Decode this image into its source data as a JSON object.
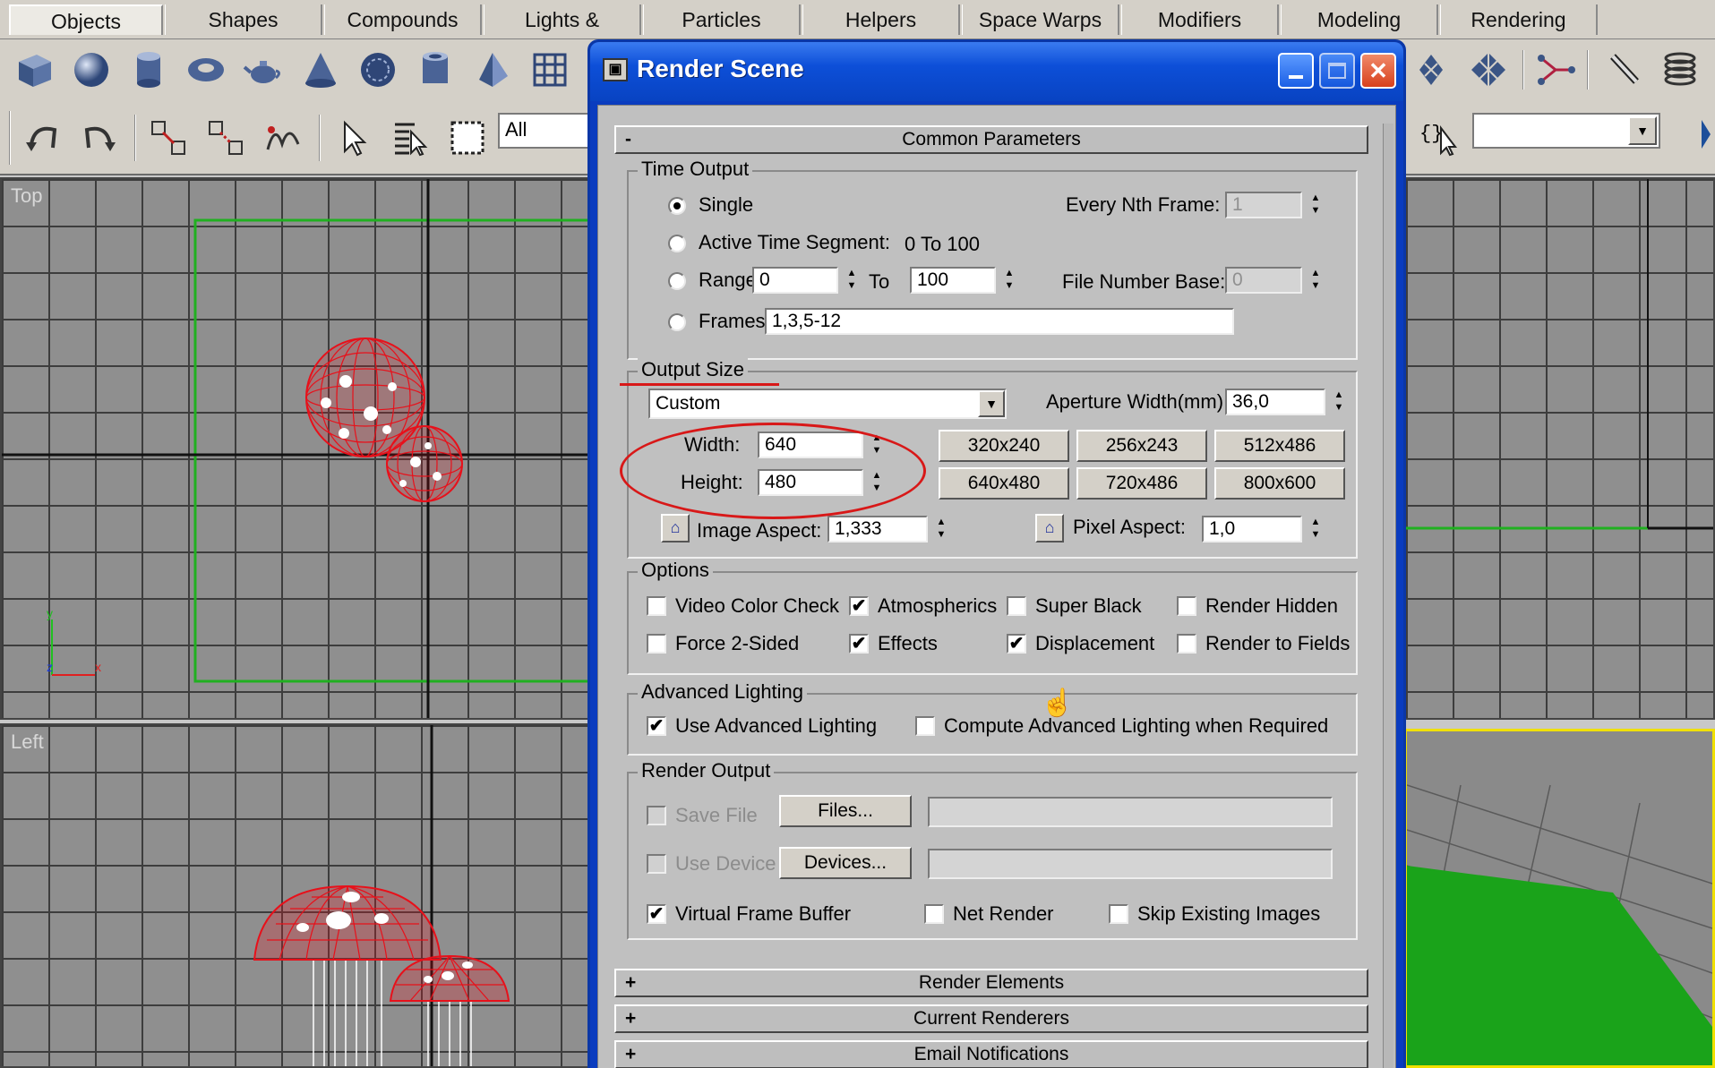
{
  "tabs": [
    "Objects",
    "Shapes",
    "Compounds",
    "Lights & Cameras",
    "Particles",
    "Helpers",
    "Space Warps",
    "Modifiers",
    "Modeling",
    "Rendering"
  ],
  "toolbar": {
    "icons1": [
      "box-icon",
      "sphere-icon",
      "cylinder-icon",
      "torus-icon",
      "teapot-icon",
      "cone-icon",
      "geosphere-icon",
      "tube-icon",
      "pyramid-icon",
      "plane-icon"
    ],
    "icons1_right": [
      "array-icon",
      "snapshot-icon",
      "connect-icon",
      "paint-icon",
      "spring-icon"
    ],
    "icons2": [
      "undo-icon",
      "redo-icon",
      "link-icon",
      "unlink-icon",
      "bind-space-warp-icon",
      "select-icon",
      "select-by-name-icon",
      "region-select-icon"
    ],
    "filter_value": "All",
    "named_selection_value": ""
  },
  "viewports": {
    "top_label": "Top",
    "left_label": "Left",
    "axis_x": "x",
    "axis_y": "y",
    "axis_z": "z"
  },
  "dialog": {
    "title": "Render Scene",
    "common_params": {
      "header": "Common Parameters",
      "toggle": "-",
      "time_output": {
        "title": "Time Output",
        "single": "Single",
        "active_segment": "Active Time Segment:",
        "active_range": "0 To 100",
        "range": "Range:",
        "range_from": "0",
        "range_to_label": "To",
        "range_to": "100",
        "frames": "Frames",
        "frames_value": "1,3,5-12",
        "every_nth_label": "Every Nth Frame:",
        "every_nth_value": "1",
        "file_number_base_label": "File Number Base:",
        "file_number_base_value": "0"
      },
      "output_size": {
        "title": "Output Size",
        "preset": "Custom",
        "aperture_label": "Aperture Width(mm):",
        "aperture_value": "36,0",
        "width_label": "Width:",
        "width_value": "640",
        "height_label": "Height:",
        "height_value": "480",
        "presets": [
          "320x240",
          "256x243",
          "512x486",
          "640x480",
          "720x486",
          "800x600"
        ],
        "image_aspect_label": "Image Aspect:",
        "image_aspect_value": "1,333",
        "pixel_aspect_label": "Pixel Aspect:",
        "pixel_aspect_value": "1,0"
      },
      "options": {
        "title": "Options",
        "video_color_check": "Video Color Check",
        "atmospherics": "Atmospherics",
        "super_black": "Super Black",
        "render_hidden": "Render Hidden",
        "force_2sided": "Force 2-Sided",
        "effects": "Effects",
        "displacement": "Displacement",
        "render_to_fields": "Render to Fields"
      },
      "advanced_lighting": {
        "title": "Advanced Lighting",
        "use": "Use Advanced Lighting",
        "compute": "Compute Advanced Lighting when Required"
      },
      "render_output": {
        "title": "Render Output",
        "save_file": "Save File",
        "files_button": "Files...",
        "use_device": "Use Device",
        "devices_button": "Devices...",
        "vfb": "Virtual Frame Buffer",
        "net_render": "Net Render",
        "skip_existing": "Skip Existing Images"
      }
    },
    "rollouts": [
      {
        "toggle": "+",
        "label": "Render Elements"
      },
      {
        "toggle": "+",
        "label": "Current Renderers"
      },
      {
        "toggle": "+",
        "label": "Email Notifications"
      }
    ],
    "checkmark": "✔",
    "lock_glyph": "⌂"
  },
  "colors": {
    "wireframe": "#e8101a",
    "selection_green": "#20b020",
    "annotation_red": "#d81818",
    "title_blue": "#0b4fd8"
  }
}
